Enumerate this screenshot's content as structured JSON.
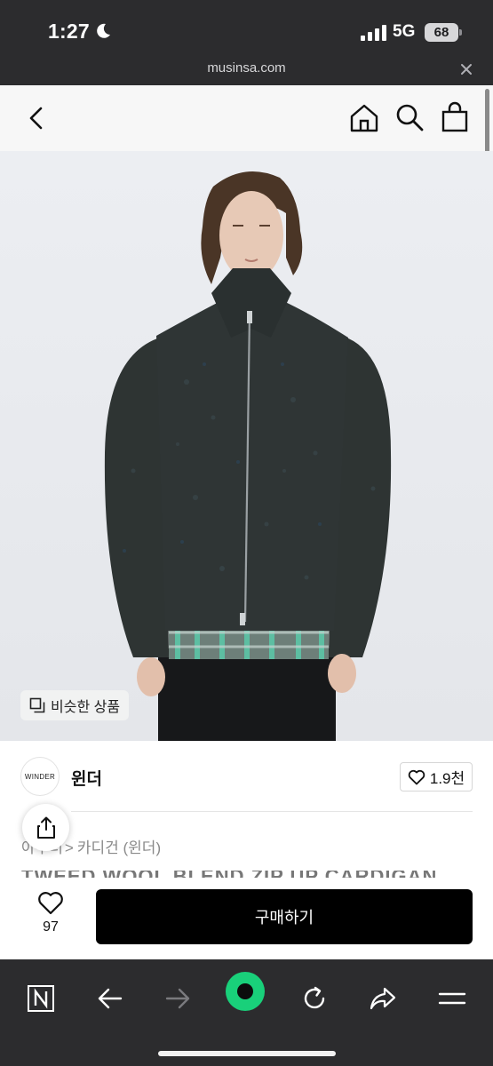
{
  "status_bar": {
    "time": "1:27",
    "network": "5G",
    "battery": "68",
    "moon_icon": "moon-icon",
    "signal_icon": "signal-bars-icon"
  },
  "browser": {
    "url": "musinsa.com",
    "toolbar_icons": [
      "naver-n-icon",
      "arrow-left-icon",
      "arrow-right-icon",
      "green-circle-icon",
      "reload-icon",
      "share-arrow-icon",
      "menu-icon"
    ]
  },
  "header": {
    "icons": [
      "chevron-left-icon",
      "home-icon",
      "search-icon",
      "shopping-bag-icon"
    ]
  },
  "product": {
    "similar_label": "비슷한 상품",
    "brand_logo_text": "WINDER",
    "brand_name": "윈더",
    "like_count": "1.9천",
    "breadcrumb_hidden": "아우터",
    "breadcrumb_category": "카디건 (윈더)",
    "title_peek": "TWEED WOOL BLEND ZIP UP CARDIGAN"
  },
  "buy_bar": {
    "wish_count": "97",
    "buy_label": "구매하기"
  },
  "colors": {
    "chrome": "#2c2c2e",
    "header_bg": "#f7f7f7",
    "image_bg": "#e9eaee",
    "buy_button": "#000000",
    "accent_green": "#19d07a"
  }
}
